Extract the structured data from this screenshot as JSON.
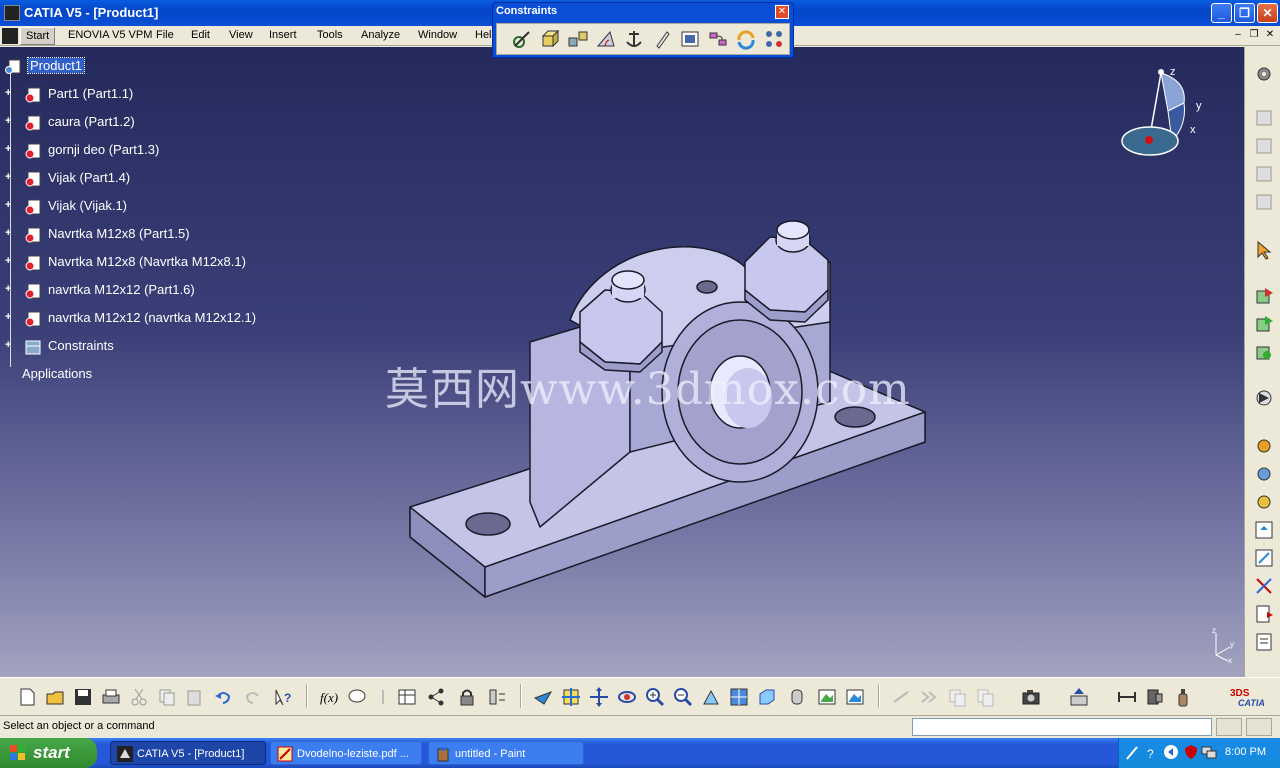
{
  "window": {
    "title": "CATIA V5 - [Product1]"
  },
  "menu": {
    "items": [
      "Start",
      "ENOVIA V5 VPM",
      "File",
      "Edit",
      "View",
      "Insert",
      "Tools",
      "Analyze",
      "Window",
      "Help"
    ]
  },
  "constraints_toolbar": {
    "title": "Constraints",
    "close": "✕",
    "tools": [
      "coincidence-constraint-icon",
      "contact-constraint-icon",
      "offset-constraint-icon",
      "angle-constraint-icon",
      "fix-component-icon",
      "fix-together-icon",
      "quick-constraint-icon",
      "flexible-rigid-subassembly-icon",
      "change-constraint-icon",
      "reuse-pattern-icon"
    ]
  },
  "tree": {
    "root": "Product1",
    "items": [
      "Part1 (Part1.1)",
      "caura (Part1.2)",
      "gornji deo (Part1.3)",
      "Vijak (Part1.4)",
      "Vijak (Vijak.1)",
      "Navrtka M12x8 (Part1.5)",
      "Navrtka M12x8 (Navrtka M12x8.1)",
      "navrtka M12x12 (Part1.6)",
      "navrtka M12x12 (navrtka M12x12.1)",
      "Constraints"
    ],
    "applications": "Applications"
  },
  "watermark": "莫西网www.3dmox.com",
  "compass": {
    "z": "z",
    "y": "y",
    "x": "x"
  },
  "status": {
    "message": "Select an object or a command"
  },
  "taskbar": {
    "start": "start",
    "tasks": [
      {
        "label": "CATIA V5 - [Product1]",
        "active": true
      },
      {
        "label": "Dvodelno-leziste.pdf ...",
        "active": false
      },
      {
        "label": "untitled - Paint",
        "active": false
      }
    ],
    "clock": "8:00 PM"
  },
  "colors": {
    "accent": "#0a4fd6",
    "viewport_top": "#252a5c",
    "viewport_bottom": "#a3a3c0",
    "part_fill": "#c4c4e8"
  }
}
